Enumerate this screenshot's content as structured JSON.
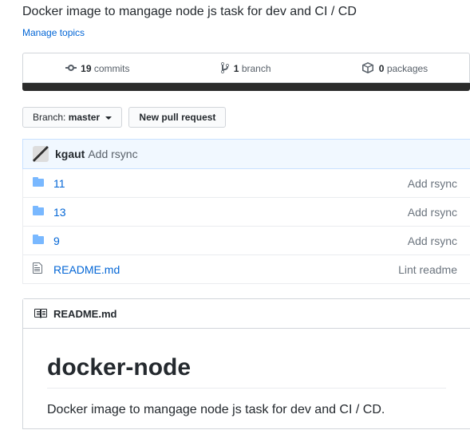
{
  "description": "Docker image to mangage node js task for dev and CI / CD",
  "manage_topics": "Manage topics",
  "stats": {
    "commits": {
      "num": "19",
      "label": "commits"
    },
    "branches": {
      "num": "1",
      "label": "branch"
    },
    "packages": {
      "num": "0",
      "label": "packages"
    }
  },
  "branch_btn": {
    "label": "Branch:",
    "value": "master"
  },
  "new_pr": "New pull request",
  "latest_commit": {
    "author": "kgaut",
    "message": "Add rsync"
  },
  "files": [
    {
      "type": "dir",
      "name": "11",
      "msg": "Add rsync"
    },
    {
      "type": "dir",
      "name": "13",
      "msg": "Add rsync"
    },
    {
      "type": "dir",
      "name": "9",
      "msg": "Add rsync"
    },
    {
      "type": "file",
      "name": "README.md",
      "msg": "Lint readme"
    }
  ],
  "readme": {
    "filename": "README.md",
    "title": "docker-node",
    "body": "Docker image to mangage node js task for dev and CI / CD."
  }
}
